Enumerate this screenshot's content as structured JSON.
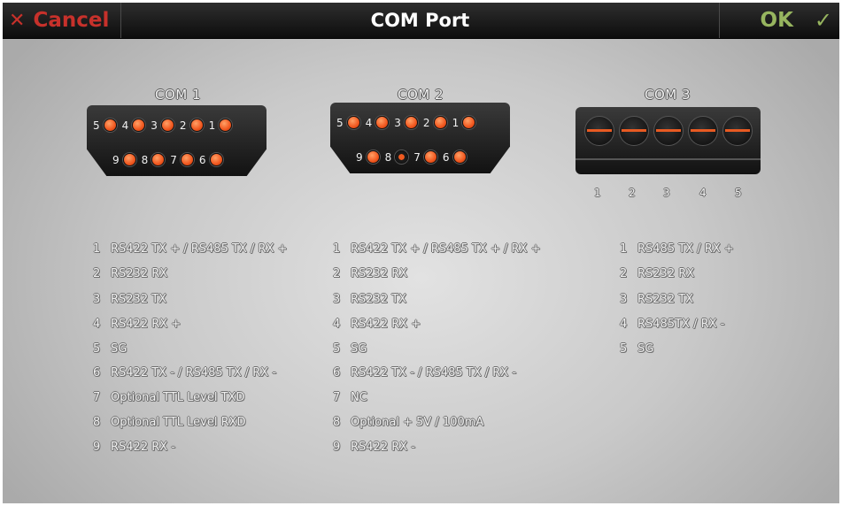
{
  "header": {
    "cancel_label": "Cancel",
    "title": "COM Port",
    "ok_label": "OK"
  },
  "icons": {
    "cancel": "close-icon",
    "ok": "check-icon"
  },
  "colors": {
    "cancel": "#c7312b",
    "ok": "#97b55f",
    "pin": "#f0561e"
  },
  "ports": [
    {
      "label": "COM 1",
      "top_pins": [
        "5",
        "4",
        "3",
        "2",
        "1"
      ],
      "bottom_pins": [
        "9",
        "8",
        "7",
        "6"
      ],
      "pins": [
        {
          "n": "1",
          "desc": "RS422 TX + / RS485 TX / RX +"
        },
        {
          "n": "2",
          "desc": "RS232 RX"
        },
        {
          "n": "3",
          "desc": "RS232 TX"
        },
        {
          "n": "4",
          "desc": "RS422 RX +"
        },
        {
          "n": "5",
          "desc": "SG"
        },
        {
          "n": "6",
          "desc": "RS422 TX - / RS485 TX / RX -"
        },
        {
          "n": "7",
          "desc": "Optional TTL Level TXD"
        },
        {
          "n": "8",
          "desc": "Optional TTL Level RXD"
        },
        {
          "n": "9",
          "desc": "RS422 RX -"
        }
      ]
    },
    {
      "label": "COM 2",
      "top_pins": [
        "5",
        "4",
        "3",
        "2",
        "1"
      ],
      "bottom_pins": [
        "9",
        "8",
        "7",
        "6"
      ],
      "pins": [
        {
          "n": "1",
          "desc": "RS422 TX + / RS485 TX + / RX +"
        },
        {
          "n": "2",
          "desc": "RS232 RX"
        },
        {
          "n": "3",
          "desc": "RS232 TX"
        },
        {
          "n": "4",
          "desc": "RS422 RX +"
        },
        {
          "n": "5",
          "desc": "SG"
        },
        {
          "n": "6",
          "desc": "RS422 TX - / RS485 TX / RX -"
        },
        {
          "n": "7",
          "desc": "NC"
        },
        {
          "n": "8",
          "desc": "Optional + 5V / 100mA"
        },
        {
          "n": "9",
          "desc": "RS422 RX -"
        }
      ]
    },
    {
      "label": "COM 3",
      "terminal_pins": [
        "1",
        "2",
        "3",
        "4",
        "5"
      ],
      "pins": [
        {
          "n": "1",
          "desc": "RS485 TX / RX +"
        },
        {
          "n": "2",
          "desc": "RS232 RX"
        },
        {
          "n": "3",
          "desc": "RS232 TX"
        },
        {
          "n": "4",
          "desc": "RS485TX / RX -"
        },
        {
          "n": "5",
          "desc": "SG"
        }
      ]
    }
  ]
}
